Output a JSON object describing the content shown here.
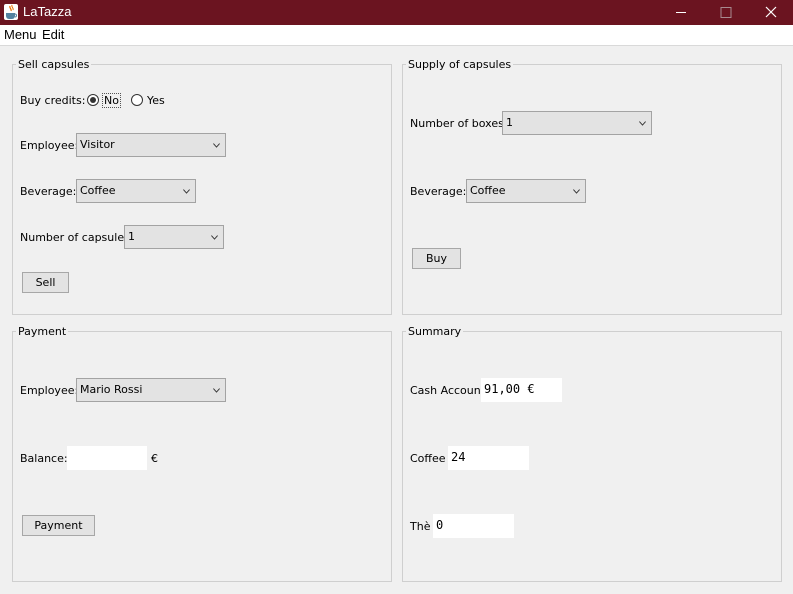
{
  "window": {
    "title": "LaTazza"
  },
  "menubar": {
    "items": [
      "Menu",
      "Edit"
    ]
  },
  "sell": {
    "title": "Sell capsules",
    "buy_credits_label": "Buy credits:",
    "radio_no": "No",
    "radio_yes": "Yes",
    "radio_selected": "No",
    "employee_label": "Employee:",
    "employee_value": "Visitor",
    "beverage_label": "Beverage:",
    "beverage_value": "Coffee",
    "capsules_label": "Number of capsules:",
    "capsules_value": "1",
    "sell_button": "Sell"
  },
  "supply": {
    "title": "Supply of capsules",
    "boxes_label": "Number of boxes:",
    "boxes_value": "1",
    "beverage_label": "Beverage:",
    "beverage_value": "Coffee",
    "buy_button": "Buy"
  },
  "payment": {
    "title": "Payment",
    "employee_label": "Employee:",
    "employee_value": "Mario Rossi",
    "balance_label": "Balance:",
    "balance_value": "",
    "currency": "€",
    "payment_button": "Payment"
  },
  "summary": {
    "title": "Summary",
    "cash_label": "Cash Account",
    "cash_value": "91,00 €",
    "coffee_label": "Coffee",
    "coffee_value": "24",
    "the_label": "Thè",
    "the_value": "0"
  },
  "colors": {
    "titlebar": "#6b1420"
  }
}
